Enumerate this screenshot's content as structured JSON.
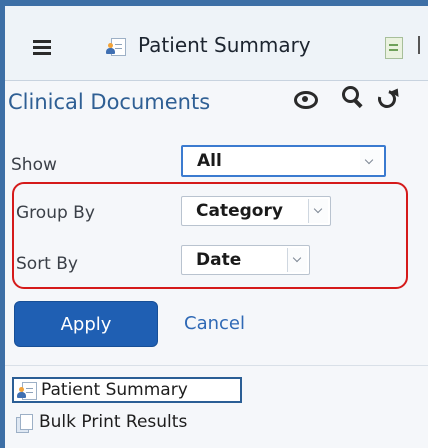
{
  "tabs": [
    {
      "label": "Patient Summary",
      "icon": "patient-summary-icon",
      "active": true
    },
    {
      "label": "",
      "icon": "results-document-icon",
      "active": false
    }
  ],
  "panel": {
    "title": "Clinical Documents",
    "toolbar_icons": [
      "eye-icon",
      "search-icon",
      "refresh-icon"
    ]
  },
  "filters": {
    "show": {
      "label": "Show",
      "value": "All"
    },
    "group_by": {
      "label": "Group By",
      "value": "Category"
    },
    "sort_by": {
      "label": "Sort By",
      "value": "Date"
    }
  },
  "actions": {
    "apply_label": "Apply",
    "cancel_label": "Cancel"
  },
  "documents": [
    {
      "label": "Patient Summary",
      "icon": "patient-summary-icon",
      "selected": true
    },
    {
      "label": "Bulk Print Results",
      "icon": "bulk-print-icon",
      "selected": false
    }
  ],
  "colors": {
    "accent": "#1f5fb3",
    "title_blue": "#2f5f94",
    "highlight_red": "#d51a1a",
    "window_frame": "#3d6fa6"
  }
}
